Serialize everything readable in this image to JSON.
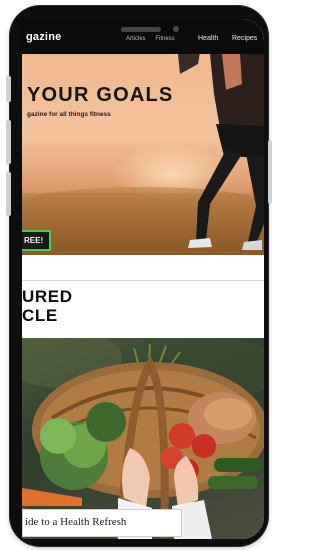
{
  "nav": {
    "brand": "gazine",
    "items": [
      "Articles",
      "Fitness"
    ],
    "health": "Health",
    "recipes": "Recipes"
  },
  "hero": {
    "title": "YOUR GOALS",
    "subtitle": "gazine for all things fitness",
    "cta": "REE!"
  },
  "section": {
    "title_line1": "URED",
    "title_line2": "CLE"
  },
  "article": {
    "card_title": "ide to a Health Refresh"
  },
  "colors": {
    "nav_bg": "#0b0b0b",
    "cta_border": "#46d04f",
    "hero_sky": "#f3c39d"
  }
}
